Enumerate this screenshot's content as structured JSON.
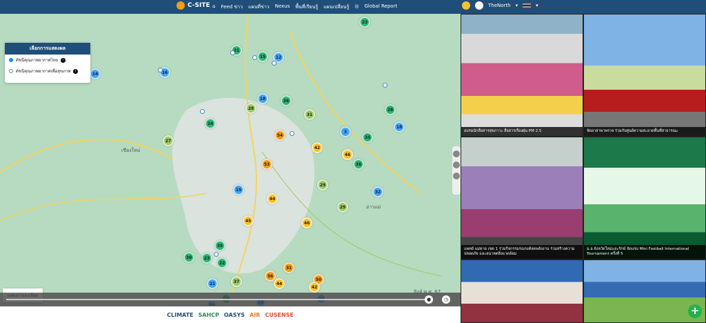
{
  "brand": {
    "name": "C-SITE"
  },
  "nav": [
    {
      "label": "Feed ข่าว",
      "icon": "home-icon"
    },
    {
      "label": "แผนที่ข่าว"
    },
    {
      "label": "Nexus"
    },
    {
      "label": "พื้นที่เรียนรู้"
    },
    {
      "label": "แผนเปลี่ยนรู้"
    },
    {
      "label": "Global Report",
      "icon": "globe-icon"
    }
  ],
  "user": {
    "name": "TheNorth"
  },
  "map": {
    "panel_title": "เลือกการแสดงผล",
    "options": [
      "ดัชนีคุณภาพอากาศไทย",
      "ดัชนีคุณภาพอากาศเพื่อสุขภาพ"
    ],
    "more_label": "แสดงรายละเอียด",
    "labels": [
      "เชียงใหม่",
      "อ่าวแม่",
      "อำเภอ"
    ],
    "clusters": [
      [
        "23",
        "#2bb673"
      ],
      [
        "21",
        "#2bb673"
      ],
      [
        "15",
        "#2bb673"
      ],
      [
        "12",
        "#42a5f5"
      ],
      [
        "16",
        "#42a5f5"
      ],
      [
        "14",
        "#42a5f5"
      ],
      [
        "36",
        "#2bb673"
      ],
      [
        "28",
        "#9ccc65"
      ],
      [
        "18",
        "#42a5f5"
      ],
      [
        "24",
        "#2bb673"
      ],
      [
        "31",
        "#9ccc65"
      ],
      [
        "35",
        "#2bb673"
      ],
      [
        "27",
        "#9ccc65"
      ],
      [
        "28",
        "#2bb673"
      ],
      [
        "18",
        "#42a5f5"
      ],
      [
        "3",
        "#42a5f5"
      ],
      [
        "46",
        "#fbc02d"
      ],
      [
        "42",
        "#fbc02d"
      ],
      [
        "53",
        "#f39c12"
      ],
      [
        "36",
        "#2bb673"
      ],
      [
        "29",
        "#9ccc65"
      ],
      [
        "32",
        "#42a5f5"
      ],
      [
        "15",
        "#42a5f5"
      ],
      [
        "45",
        "#fbc02d"
      ],
      [
        "44",
        "#fbc02d"
      ],
      [
        "46",
        "#fbc02d"
      ],
      [
        "29",
        "#9ccc65"
      ],
      [
        "30",
        "#2bb673"
      ],
      [
        "23",
        "#2bb673"
      ],
      [
        "22",
        "#2bb673"
      ],
      [
        "35",
        "#2bb673"
      ],
      [
        "56",
        "#f39c12"
      ],
      [
        "37",
        "#9ccc65"
      ],
      [
        "50",
        "#f39c12"
      ],
      [
        "31",
        "#f39c12"
      ],
      [
        "21",
        "#42a5f5"
      ],
      [
        "44",
        "#fbc02d"
      ],
      [
        "42",
        "#fbc02d"
      ],
      [
        "25",
        "#2bb673"
      ],
      [
        "16",
        "#42a5f5"
      ],
      [
        "25",
        "#42a5f5"
      ],
      [
        "20",
        "#42a5f5"
      ],
      [
        "54",
        "#f39c12"
      ]
    ],
    "copyright": "สิงห์ พ.ศ. 67"
  },
  "footer": {
    "logos": [
      "CLIMATE",
      "SAHCP",
      "OASYS",
      "AIR",
      "CUSENSE"
    ]
  },
  "gallery": [
    {
      "caption": "อบรมนักสื่อสารสุขภาวะ สื่อสารเรื่องฝุ่น PM 2.5"
    },
    {
      "caption": "จัดอาสาพาพรวจ ร่วมกับศูนย์ความสะอาดพื้นที่สาธารณะ"
    },
    {
      "caption": "แพทย์ แม่ทาย เขต 1 ร่วมกิจกรรมรณรงค์ลดพลังงาน ร่วมสร้างความปลอดภัย และอนาคตสิ่งแวดล้อม"
    },
    {
      "caption": "ม.อ.จังหวัดใหม่และรักษ์ จัดแข่ง Mini Football International Tournament ครั้งที่ 5"
    },
    {
      "caption": ""
    },
    {
      "caption": ""
    }
  ]
}
